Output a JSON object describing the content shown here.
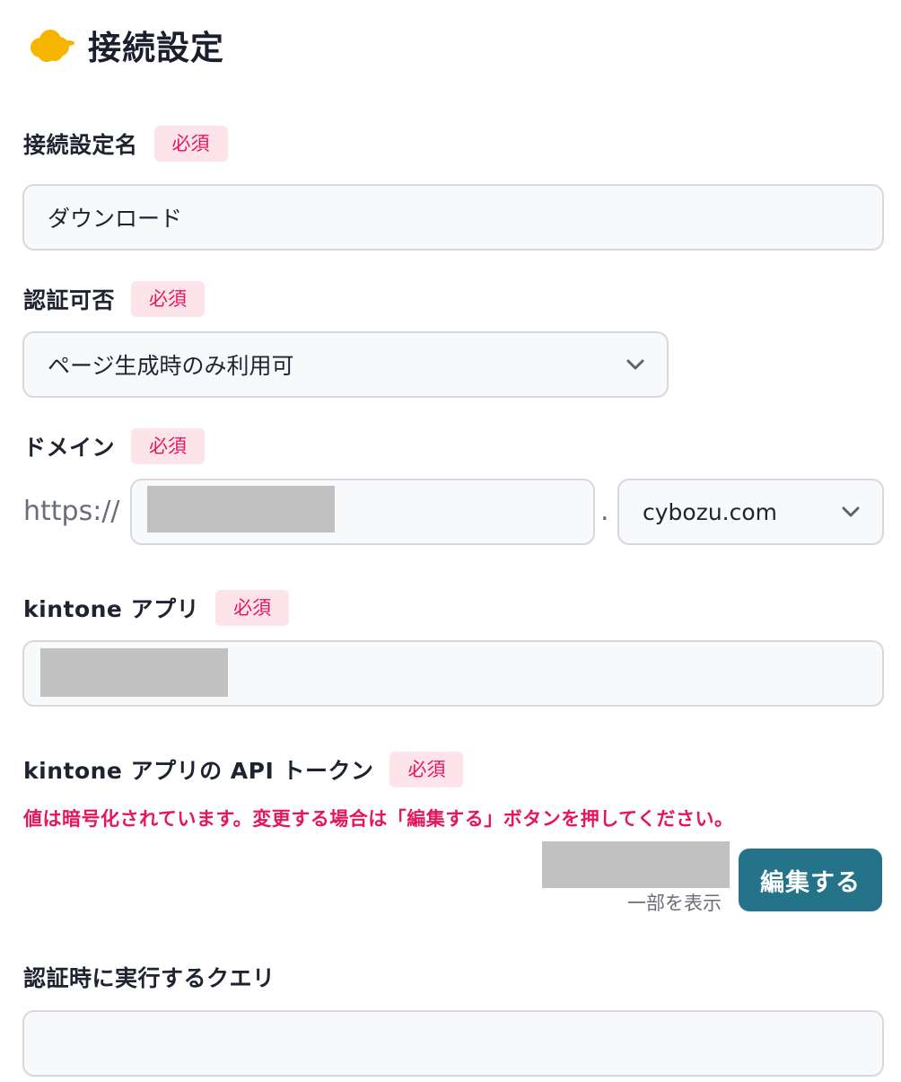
{
  "header": {
    "title": "接続設定",
    "icon": "cloud-icon"
  },
  "colors": {
    "accent": "#257389",
    "required": "#e5175c",
    "required_bg": "#fde3ea",
    "icon": "#f7b500"
  },
  "required_label": "必須",
  "fields": {
    "connection_name": {
      "label": "接続設定名",
      "value": "ダウンロード"
    },
    "auth": {
      "label": "認証可否",
      "value": "ページ生成時のみ利用可"
    },
    "domain": {
      "label": "ドメイン",
      "prefix": "https://",
      "separator": ".",
      "suffix_value": "cybozu.com"
    },
    "kintone_app": {
      "label": "kintone アプリ"
    },
    "api_token": {
      "label": "kintone アプリの API トークン",
      "warning": "値は暗号化されています。変更する場合は「編集する」ボタンを押してください。",
      "hint": "一部を表示",
      "edit_button": "編集する"
    },
    "auth_query": {
      "label": "認証時に実行するクエリ",
      "value": ""
    }
  }
}
